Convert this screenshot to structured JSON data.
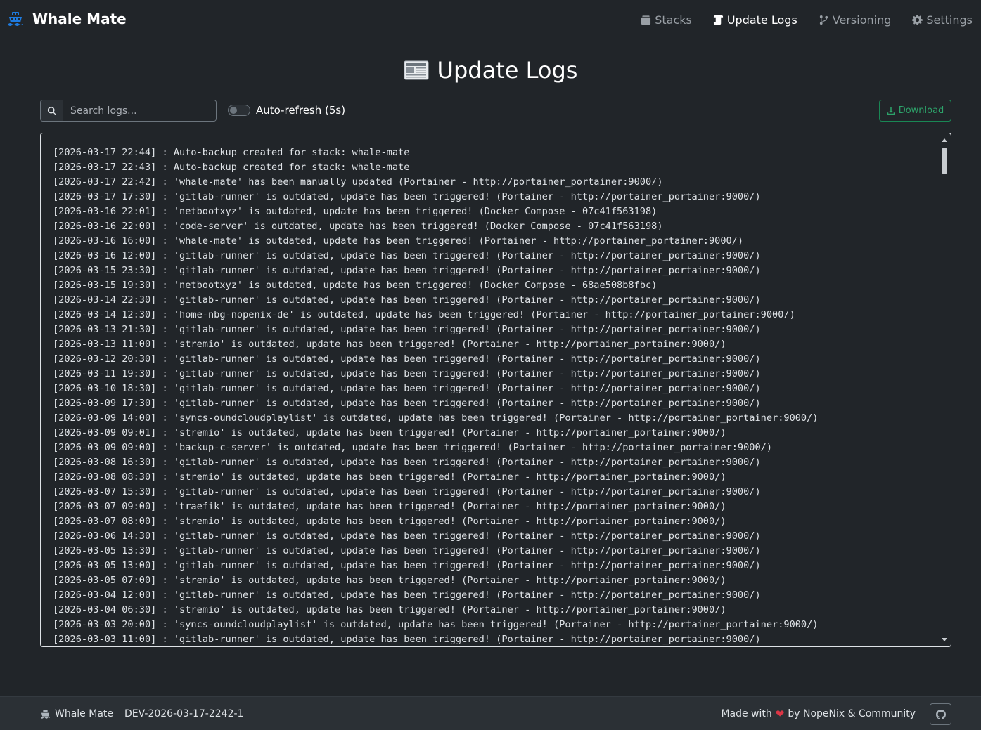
{
  "app": {
    "name": "Whale Mate",
    "icon": "ship-icon",
    "accent": "#1e7be0"
  },
  "nav": {
    "items": [
      {
        "label": "Stacks",
        "icon": "layers-icon",
        "active": false
      },
      {
        "label": "Update Logs",
        "icon": "scroll-icon",
        "active": true
      },
      {
        "label": "Versioning",
        "icon": "branch-icon",
        "active": false
      },
      {
        "label": "Settings",
        "icon": "gear-icon",
        "active": false
      }
    ]
  },
  "page": {
    "title": "Update Logs",
    "title_icon": "newspaper-icon"
  },
  "toolbar": {
    "search_placeholder": "Search logs...",
    "search_value": "",
    "auto_refresh_label": "Auto-refresh (5s)",
    "auto_refresh_on": false,
    "download_label": "Download"
  },
  "logs": [
    "[2026-03-17 22:44] : Auto-backup created for stack: whale-mate",
    "[2026-03-17 22:43] : Auto-backup created for stack: whale-mate",
    "[2026-03-17 22:42] : 'whale-mate' has been manually updated (Portainer - http://portainer_portainer:9000/)",
    "[2026-03-17 17:30] : 'gitlab-runner' is outdated, update has been triggered! (Portainer - http://portainer_portainer:9000/)",
    "[2026-03-16 22:01] : 'netbootxyz' is outdated, update has been triggered! (Docker Compose - 07c41f563198)",
    "[2026-03-16 22:00] : 'code-server' is outdated, update has been triggered! (Docker Compose - 07c41f563198)",
    "[2026-03-16 16:00] : 'whale-mate' is outdated, update has been triggered! (Portainer - http://portainer_portainer:9000/)",
    "[2026-03-16 12:00] : 'gitlab-runner' is outdated, update has been triggered! (Portainer - http://portainer_portainer:9000/)",
    "[2026-03-15 23:30] : 'gitlab-runner' is outdated, update has been triggered! (Portainer - http://portainer_portainer:9000/)",
    "[2026-03-15 19:30] : 'netbootxyz' is outdated, update has been triggered! (Docker Compose - 68ae508b8fbc)",
    "[2026-03-14 22:30] : 'gitlab-runner' is outdated, update has been triggered! (Portainer - http://portainer_portainer:9000/)",
    "[2026-03-14 12:30] : 'home-nbg-nopenix-de' is outdated, update has been triggered! (Portainer - http://portainer_portainer:9000/)",
    "[2026-03-13 21:30] : 'gitlab-runner' is outdated, update has been triggered! (Portainer - http://portainer_portainer:9000/)",
    "[2026-03-13 11:00] : 'stremio' is outdated, update has been triggered! (Portainer - http://portainer_portainer:9000/)",
    "[2026-03-12 20:30] : 'gitlab-runner' is outdated, update has been triggered! (Portainer - http://portainer_portainer:9000/)",
    "[2026-03-11 19:30] : 'gitlab-runner' is outdated, update has been triggered! (Portainer - http://portainer_portainer:9000/)",
    "[2026-03-10 18:30] : 'gitlab-runner' is outdated, update has been triggered! (Portainer - http://portainer_portainer:9000/)",
    "[2026-03-09 17:30] : 'gitlab-runner' is outdated, update has been triggered! (Portainer - http://portainer_portainer:9000/)",
    "[2026-03-09 14:00] : 'syncs-oundcloudplaylist' is outdated, update has been triggered! (Portainer - http://portainer_portainer:9000/)",
    "[2026-03-09 09:01] : 'stremio' is outdated, update has been triggered! (Portainer - http://portainer_portainer:9000/)",
    "[2026-03-09 09:00] : 'backup-c-server' is outdated, update has been triggered! (Portainer - http://portainer_portainer:9000/)",
    "[2026-03-08 16:30] : 'gitlab-runner' is outdated, update has been triggered! (Portainer - http://portainer_portainer:9000/)",
    "[2026-03-08 08:30] : 'stremio' is outdated, update has been triggered! (Portainer - http://portainer_portainer:9000/)",
    "[2026-03-07 15:30] : 'gitlab-runner' is outdated, update has been triggered! (Portainer - http://portainer_portainer:9000/)",
    "[2026-03-07 09:00] : 'traefik' is outdated, update has been triggered! (Portainer - http://portainer_portainer:9000/)",
    "[2026-03-07 08:00] : 'stremio' is outdated, update has been triggered! (Portainer - http://portainer_portainer:9000/)",
    "[2026-03-06 14:30] : 'gitlab-runner' is outdated, update has been triggered! (Portainer - http://portainer_portainer:9000/)",
    "[2026-03-05 13:30] : 'gitlab-runner' is outdated, update has been triggered! (Portainer - http://portainer_portainer:9000/)",
    "[2026-03-05 13:00] : 'gitlab-runner' is outdated, update has been triggered! (Portainer - http://portainer_portainer:9000/)",
    "[2026-03-05 07:00] : 'stremio' is outdated, update has been triggered! (Portainer - http://portainer_portainer:9000/)",
    "[2026-03-04 12:00] : 'gitlab-runner' is outdated, update has been triggered! (Portainer - http://portainer_portainer:9000/)",
    "[2026-03-04 06:30] : 'stremio' is outdated, update has been triggered! (Portainer - http://portainer_portainer:9000/)",
    "[2026-03-03 20:00] : 'syncs-oundcloudplaylist' is outdated, update has been triggered! (Portainer - http://portainer_portainer:9000/)",
    "[2026-03-03 11:00] : 'gitlab-runner' is outdated, update has been triggered! (Portainer - http://portainer_portainer:9000/)"
  ],
  "footer": {
    "app_name": "Whale Mate",
    "version": "DEV-2026-03-17-2242-1",
    "made_with_prefix": "Made with",
    "made_with_suffix": "by NopeNix & Community",
    "heart_color": "#dc3545",
    "github_icon": "github-icon"
  }
}
